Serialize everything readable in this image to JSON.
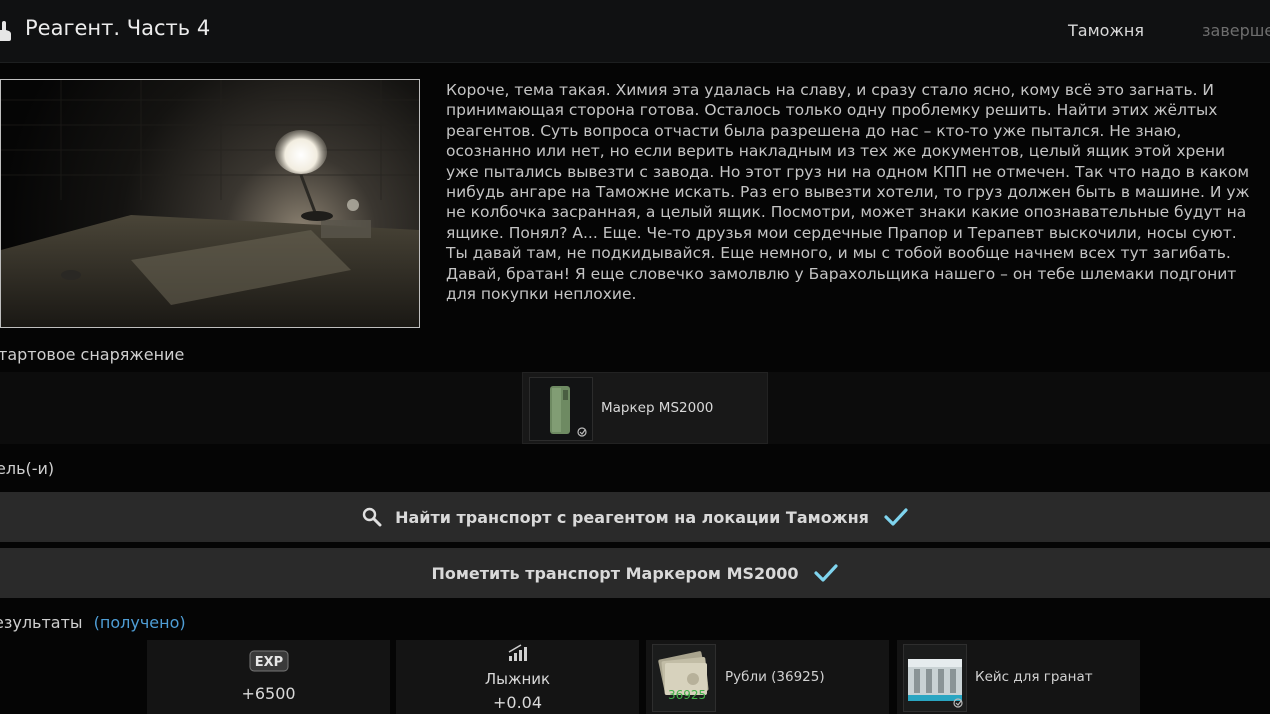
{
  "header": {
    "title": "Реагент. Часть 4",
    "location": "Таможня",
    "status": "заверше"
  },
  "briefing": {
    "lines": [
      "Короче, тема такая. Химия эта удалась на славу, и сразу стало ясно, кому всё это загнать. И",
      "принимающая сторона готова. Осталось только одну проблемку решить. Найти этих жёлтых",
      "реагентов. Суть вопроса отчасти была разрешена до нас – кто-то уже пытался. Не знаю,",
      "осознанно или нет, но если верить накладным из тех же документов, целый ящик этой хрени",
      "уже пытались вывезти с завода. Но этот груз ни на одном КПП не отмечен. Так что надо в каком",
      "нибудь ангаре на Таможне искать. Раз его вывезти хотели, то груз должен быть в машине. И уж",
      "не колбочка засранная, а целый ящик. Посмотри, может знаки какие опознавательные будут на",
      "ящике. Понял? А... Еще. Че-то друзья мои сердечные Прапор и Терапевт выскочили, носы суют.",
      "Ты давай там, не подкидывайся. Еще немного, и мы с тобой вообще начнем всех тут загибать.",
      "Давай, братан! Я еще словечко замолвлю у Барахольщика нашего – он тебе шлемаки подгонит",
      "для покупки неплохие."
    ]
  },
  "start_gear": {
    "label": "тартовое снаряжение",
    "item_name": "Маркер MS2000"
  },
  "objectives": {
    "label": "ель(-и)",
    "items": [
      {
        "text": "Найти транспорт с реагентом на локации Таможня"
      },
      {
        "text": "Пометить транспорт Маркером MS2000"
      }
    ]
  },
  "rewards": {
    "label": "езультаты",
    "received": "(получено)",
    "exp_badge": "EXP",
    "exp_value": "+6500",
    "standing_name": "Лыжник",
    "standing_value": "+0.04",
    "rubles_name": "Рубли (36925)",
    "rubles_count": "36925",
    "item_name": "Кейс для гранат"
  },
  "colors": {
    "accent_blue": "#4f9ed6",
    "check_cyan": "#7fd4ee",
    "money_green": "#43b04a"
  }
}
